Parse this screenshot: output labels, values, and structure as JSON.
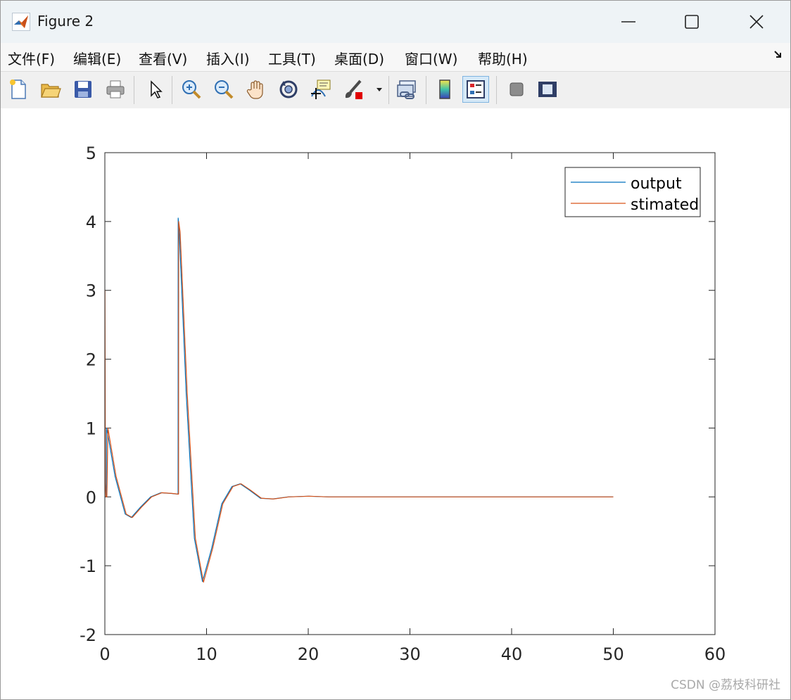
{
  "window": {
    "title": "Figure 2",
    "icon": "matlab-logo-icon",
    "controls": [
      "minimize-icon",
      "maximize-icon",
      "close-icon"
    ]
  },
  "menu": [
    {
      "name": "file",
      "label": "文件(F)"
    },
    {
      "name": "edit",
      "label": "编辑(E)"
    },
    {
      "name": "view",
      "label": "查看(V)"
    },
    {
      "name": "insert",
      "label": "插入(I)"
    },
    {
      "name": "tools",
      "label": "工具(T)"
    },
    {
      "name": "desktop",
      "label": "桌面(D)"
    },
    {
      "name": "window",
      "label": "窗口(W)"
    },
    {
      "name": "help",
      "label": "帮助(H)"
    }
  ],
  "toolbar": {
    "buttons": [
      {
        "name": "new-figure",
        "icon": "new-file-icon"
      },
      {
        "name": "open-file",
        "icon": "folder-open-icon"
      },
      {
        "name": "save-figure",
        "icon": "save-icon"
      },
      {
        "name": "print-figure",
        "icon": "printer-icon"
      },
      {
        "name": "edit-plot",
        "icon": "pointer-arrow-icon"
      },
      {
        "name": "zoom-in",
        "icon": "zoom-in-icon"
      },
      {
        "name": "zoom-out",
        "icon": "zoom-out-icon"
      },
      {
        "name": "pan",
        "icon": "hand-icon"
      },
      {
        "name": "rotate-3d",
        "icon": "rotate-icon"
      },
      {
        "name": "data-cursor",
        "icon": "data-tip-icon"
      },
      {
        "name": "brush",
        "icon": "brush-icon"
      },
      {
        "name": "link-plot",
        "icon": "link-icon"
      },
      {
        "name": "insert-colorbar",
        "icon": "colorbar-icon"
      },
      {
        "name": "insert-legend",
        "icon": "legend-icon"
      },
      {
        "name": "hide-plot-tools",
        "icon": "hide-tools-icon"
      },
      {
        "name": "show-plot-tools",
        "icon": "show-tools-icon"
      }
    ],
    "active": "insert-legend"
  },
  "chart_data": {
    "type": "line",
    "title": "",
    "xlabel": "",
    "ylabel": "",
    "xlim": [
      0,
      60
    ],
    "ylim": [
      -2,
      5
    ],
    "xticks": [
      0,
      10,
      20,
      30,
      40,
      50,
      60
    ],
    "yticks": [
      -2,
      -1,
      0,
      1,
      2,
      3,
      4,
      5
    ],
    "grid": false,
    "legend_position": "top-right",
    "series": [
      {
        "name": "output",
        "color": "#0072BD",
        "x": [
          0,
          0.15,
          0.16,
          0.3,
          1.0,
          2.0,
          2.6,
          3.5,
          4.5,
          5.5,
          6.5,
          7.2,
          7.21,
          7.3,
          8.0,
          8.8,
          9.6,
          10.5,
          11.5,
          12.5,
          13.3,
          14.2,
          15.3,
          16.5,
          18.0,
          20.0,
          22.0,
          30.0,
          40.0,
          50.0
        ],
        "values": [
          0,
          0,
          1.0,
          0.9,
          0.3,
          -0.25,
          -0.3,
          -0.15,
          0.0,
          0.06,
          0.05,
          0.04,
          4.05,
          3.9,
          1.5,
          -0.6,
          -1.23,
          -0.75,
          -0.1,
          0.15,
          0.19,
          0.1,
          -0.02,
          -0.03,
          0.0,
          0.01,
          0.0,
          0.0,
          0.0,
          0.0
        ]
      },
      {
        "name": "stimated",
        "color": "#D95319",
        "x": [
          0,
          0.01,
          0.05,
          0.1,
          0.2,
          0.3,
          1.1,
          2.1,
          2.7,
          3.6,
          4.6,
          5.6,
          6.6,
          7.25,
          7.26,
          7.4,
          8.1,
          8.9,
          9.7,
          10.6,
          11.6,
          12.6,
          13.4,
          14.3,
          15.4,
          16.6,
          18.1,
          20.1,
          22.0,
          30.0,
          40.0,
          50.0
        ],
        "values": [
          3.0,
          3.0,
          0.2,
          0.0,
          0.0,
          1.0,
          0.3,
          -0.25,
          -0.3,
          -0.15,
          0.0,
          0.06,
          0.05,
          0.04,
          4.0,
          3.85,
          1.5,
          -0.6,
          -1.24,
          -0.75,
          -0.1,
          0.15,
          0.19,
          0.1,
          -0.02,
          -0.03,
          0.0,
          0.01,
          0.0,
          0.0,
          0.0,
          0.0
        ]
      }
    ]
  },
  "watermark": "CSDN @荔枝科研社"
}
